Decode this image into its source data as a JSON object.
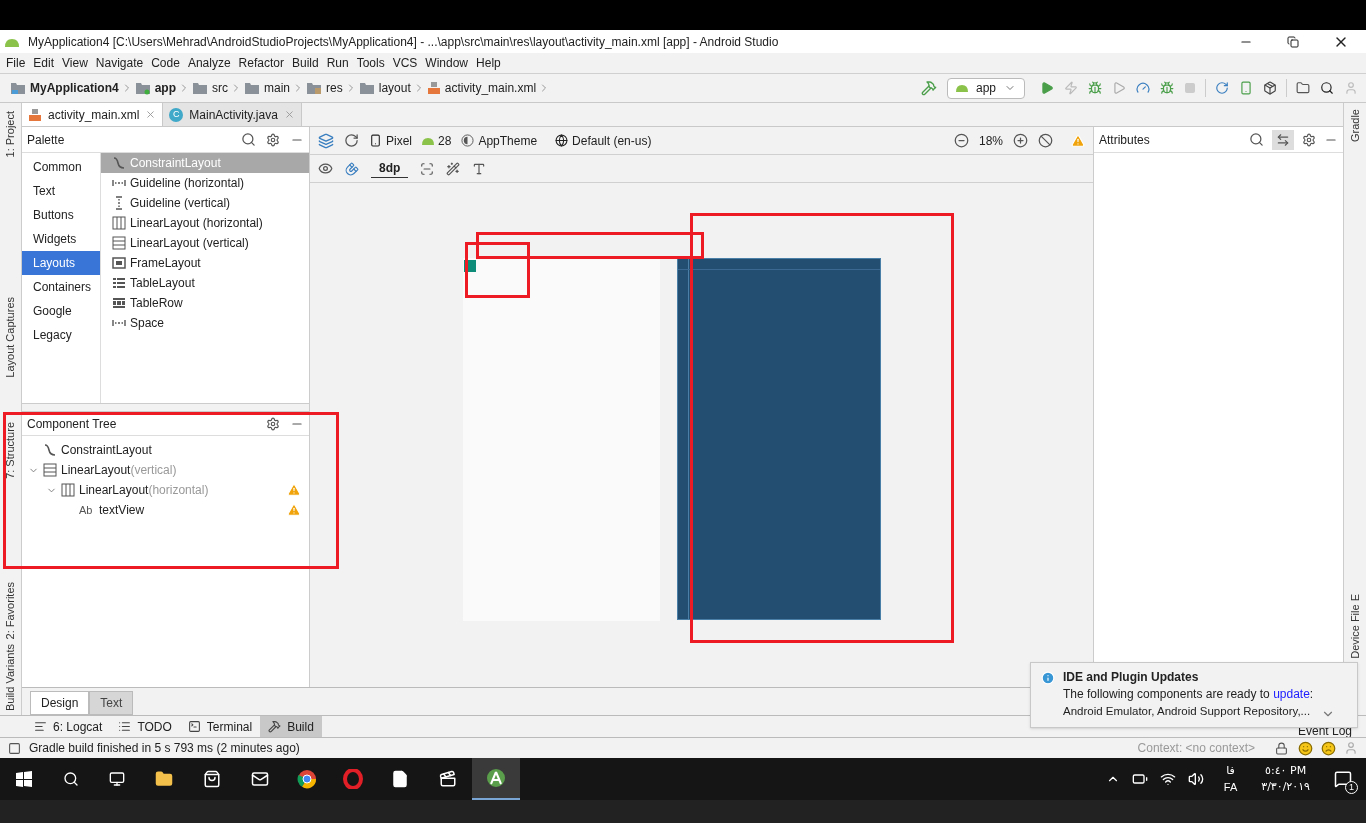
{
  "window": {
    "title": "MyApplication4 [C:\\Users\\Mehrad\\AndroidStudioProjects\\MyApplication4] - ...\\app\\src\\main\\res\\layout\\activity_main.xml [app] - Android Studio"
  },
  "menu": [
    "File",
    "Edit",
    "View",
    "Navigate",
    "Code",
    "Analyze",
    "Refactor",
    "Build",
    "Run",
    "Tools",
    "VCS",
    "Window",
    "Help"
  ],
  "breadcrumbs": [
    {
      "label": "MyApplication4",
      "kind": "project"
    },
    {
      "label": "app",
      "kind": "module"
    },
    {
      "label": "src",
      "kind": "folder"
    },
    {
      "label": "main",
      "kind": "folder"
    },
    {
      "label": "res",
      "kind": "res"
    },
    {
      "label": "layout",
      "kind": "folder"
    },
    {
      "label": "activity_main.xml",
      "kind": "xml"
    }
  ],
  "run_config": "app",
  "editor_tabs": [
    {
      "label": "activity_main.xml",
      "kind": "xml",
      "selected": true
    },
    {
      "label": "MainActivity.java",
      "kind": "java",
      "icon": "C",
      "selected": false
    }
  ],
  "left_strip": {
    "top": [
      "1: Project"
    ],
    "middle": [
      "Layout Captures",
      "7: Structure"
    ],
    "bottom": [
      "2: Favorites",
      "Build Variants"
    ]
  },
  "palette": {
    "title": "Palette",
    "categories": [
      {
        "label": "Common",
        "selected": false
      },
      {
        "label": "Text",
        "selected": false
      },
      {
        "label": "Buttons",
        "selected": false
      },
      {
        "label": "Widgets",
        "selected": false
      },
      {
        "label": "Layouts",
        "selected": true
      },
      {
        "label": "Containers",
        "selected": false
      },
      {
        "label": "Google",
        "selected": false
      },
      {
        "label": "Legacy",
        "selected": false
      }
    ],
    "items": [
      {
        "label": "ConstraintLayout",
        "kind": "constraint",
        "selected": true
      },
      {
        "label": "Guideline (horizontal)",
        "kind": "hguide",
        "selected": false
      },
      {
        "label": "Guideline (vertical)",
        "kind": "vguide",
        "selected": false
      },
      {
        "label": "LinearLayout (horizontal)",
        "kind": "hlinear",
        "selected": false
      },
      {
        "label": "LinearLayout (vertical)",
        "kind": "vlinear",
        "selected": false
      },
      {
        "label": "FrameLayout",
        "kind": "frame",
        "selected": false
      },
      {
        "label": "TableLayout",
        "kind": "table",
        "selected": false
      },
      {
        "label": "TableRow",
        "kind": "tablerow",
        "selected": false
      },
      {
        "label": "Space",
        "kind": "hguide",
        "selected": false
      }
    ]
  },
  "component_tree": {
    "title": "Component Tree",
    "nodes": [
      {
        "label": "ConstraintLayout",
        "kind": "constraint",
        "warning": false
      },
      {
        "label": "LinearLayout",
        "kind": "vlinear",
        "hint": "(vertical)",
        "warning": false,
        "expanded": true,
        "children": [
          {
            "label": "LinearLayout",
            "kind": "hlinear",
            "hint": "(horizontal)",
            "warning": true,
            "expanded": true,
            "children": [
              {
                "label": "textView",
                "kind": "text",
                "icon": "Ab",
                "warning": true
              }
            ]
          }
        ]
      }
    ]
  },
  "design_toolbar": {
    "device": "Pixel",
    "api": "28",
    "theme": "AppTheme",
    "locale": "Default (en-us)",
    "zoom": "18%",
    "margin": "8dp"
  },
  "attributes": {
    "title": "Attributes"
  },
  "right_strip": [
    "Gradle",
    "Device File E"
  ],
  "design_tabs": [
    {
      "label": "Design",
      "selected": true
    },
    {
      "label": "Text",
      "selected": false
    }
  ],
  "tool_windows": [
    {
      "label": "6: Logcat",
      "kind": "logcat",
      "selected": false
    },
    {
      "label": "TODO",
      "kind": "todo",
      "selected": false
    },
    {
      "label": "Terminal",
      "kind": "terminal",
      "selected": false
    },
    {
      "label": "Build",
      "kind": "build",
      "selected": true
    }
  ],
  "event_log": "Event Log",
  "status_bar": {
    "message": "Gradle build finished in 5 s 793 ms (2 minutes ago)",
    "context": "Context: <no context>"
  },
  "notification": {
    "title": "IDE and Plugin Updates",
    "text": "The following components are ready to",
    "link": "update",
    "text_end": ":",
    "detail": "Android Emulator, Android Support Repository,..."
  },
  "taskbar": {
    "lang_native": "فا",
    "lang": "FA",
    "time": "٥:٤٠ PM",
    "date": "٣/٣٠/٢٠١٩",
    "badge": "1"
  }
}
